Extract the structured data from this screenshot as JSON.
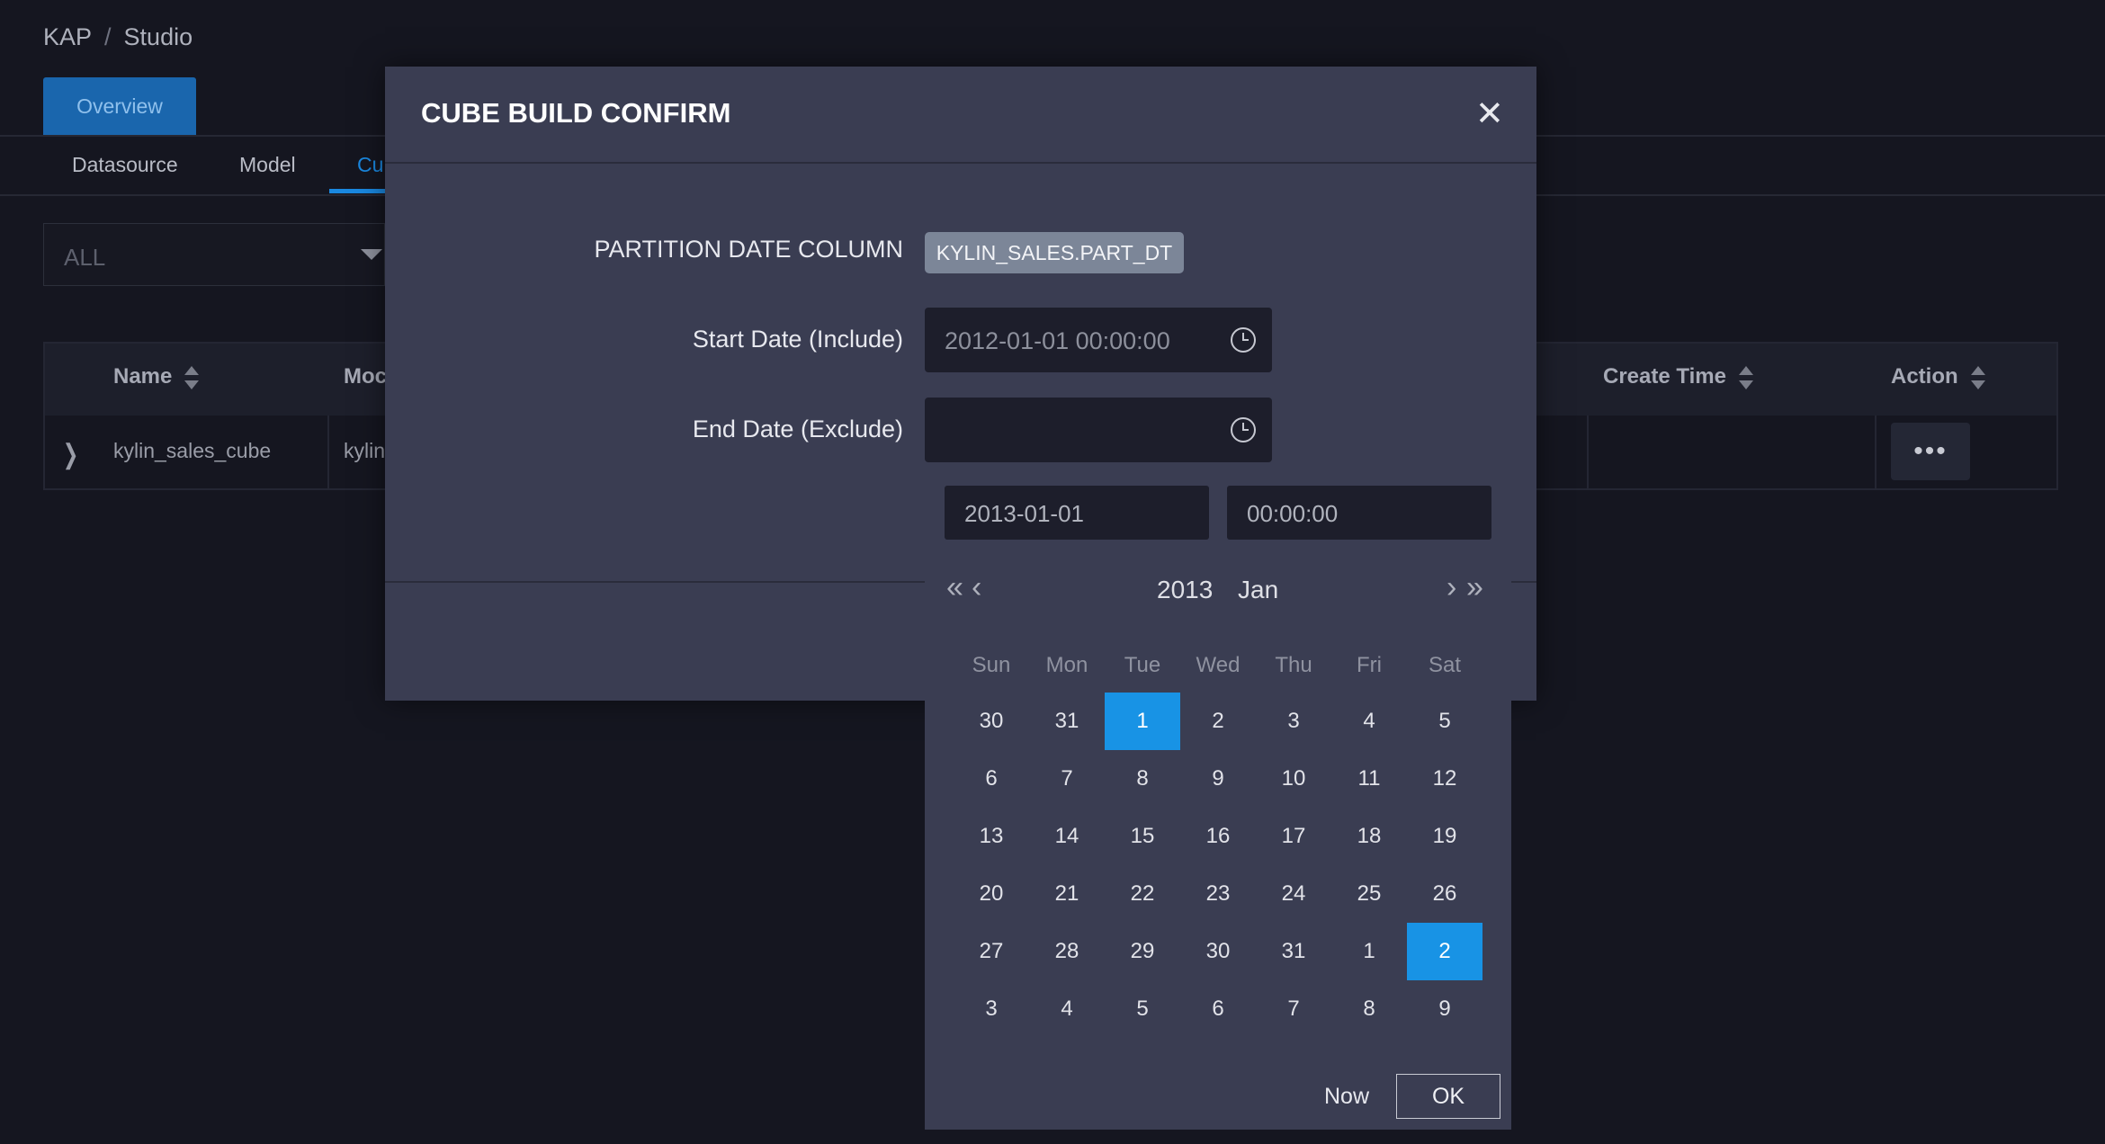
{
  "breadcrumb": {
    "root": "KAP",
    "separator": "/",
    "current": "Studio"
  },
  "top_tab": {
    "label": "Overview"
  },
  "subtabs": [
    "Datasource",
    "Model",
    "Cu"
  ],
  "filter": {
    "value": "ALL"
  },
  "table": {
    "headers": {
      "name": "Name",
      "model": "Moc",
      "create_time": "Create Time",
      "action": "Action"
    },
    "rows": [
      {
        "name": "kylin_sales_cube",
        "model": "kylin"
      }
    ],
    "more_label": "•••"
  },
  "modal": {
    "title": "CUBE BUILD CONFIRM",
    "close": "✕",
    "partition_label": "PARTITION DATE COLUMN",
    "partition_value": "KYLIN_SALES.PART_DT",
    "start_label": "Start Date (Include)",
    "start_value": "2012-01-01 00:00:00",
    "end_label": "End Date (Exclude)",
    "end_value": ""
  },
  "picker": {
    "date_input": "2013-01-01",
    "time_input": "00:00:00",
    "prev_year": "«",
    "prev_month": "‹",
    "next_month": "›",
    "next_year": "»",
    "year": "2013",
    "month": "Jan",
    "weekdays": [
      "Sun",
      "Mon",
      "Tue",
      "Wed",
      "Thu",
      "Fri",
      "Sat"
    ],
    "weeks": [
      [
        "30",
        "31",
        "1",
        "2",
        "3",
        "4",
        "5"
      ],
      [
        "6",
        "7",
        "8",
        "9",
        "10",
        "11",
        "12"
      ],
      [
        "13",
        "14",
        "15",
        "16",
        "17",
        "18",
        "19"
      ],
      [
        "20",
        "21",
        "22",
        "23",
        "24",
        "25",
        "26"
      ],
      [
        "27",
        "28",
        "29",
        "30",
        "31",
        "1",
        "2"
      ],
      [
        "3",
        "4",
        "5",
        "6",
        "7",
        "8",
        "9"
      ]
    ],
    "selected": [
      [
        0,
        2
      ],
      [
        4,
        6
      ]
    ],
    "now_label": "Now",
    "ok_label": "OK",
    "accent": "#1893e5"
  }
}
